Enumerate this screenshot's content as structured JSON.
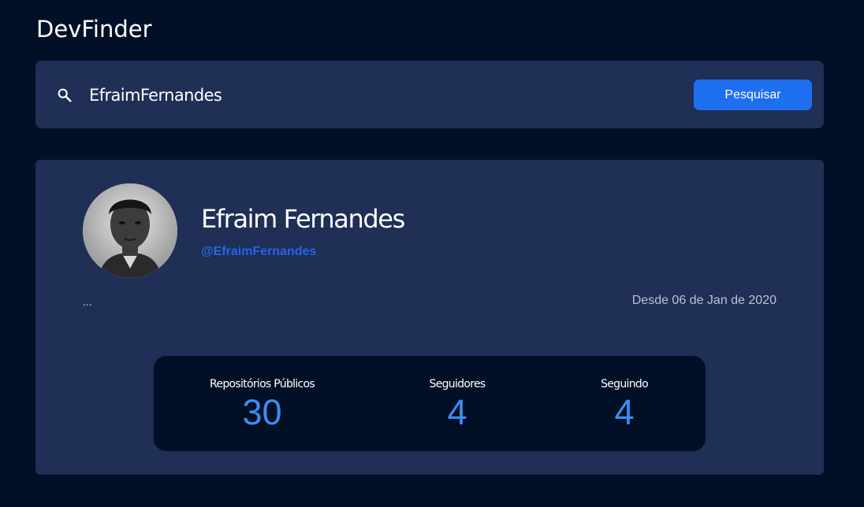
{
  "app": {
    "title": "DevFinder"
  },
  "search": {
    "value": "EfraimFernandes",
    "placeholder": "",
    "button_label": "Pesquisar",
    "icon": "search-icon"
  },
  "profile": {
    "name": "Efraim Fernandes",
    "login": "@EfraimFernandes",
    "bio": "...",
    "joined": "Desde 06 de Jan de 2020",
    "avatar_icon": "avatar-photo"
  },
  "stats": [
    {
      "label": "Repositórios Públicos",
      "value": "30"
    },
    {
      "label": "Seguidores",
      "value": "4"
    },
    {
      "label": "Seguindo",
      "value": "4"
    }
  ],
  "colors": {
    "background": "#021027",
    "card": "#1f2f56",
    "accent": "#1e6ff0",
    "link": "#2864e6",
    "stat_value": "#3d8cf0"
  }
}
